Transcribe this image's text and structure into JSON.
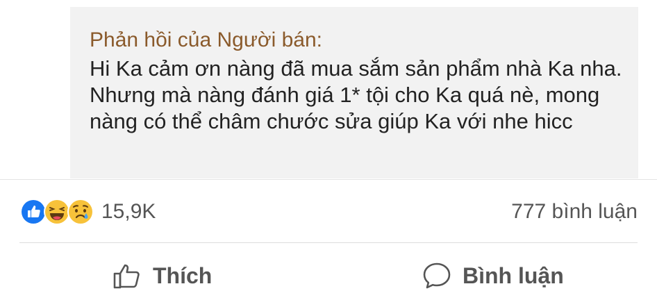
{
  "reply": {
    "label": "Phản hồi của Người bán:",
    "text": "Hi Ka cảm ơn nàng đã mua sắm sản phẩm nhà Ka nha. Nhưng mà nàng đánh giá 1* tội cho Ka quá nè, mong nàng có thể châm chước sửa giúp Ka với nhe hicc"
  },
  "stats": {
    "reactions": [
      "like-icon",
      "haha-icon",
      "sad-icon"
    ],
    "reaction_count": "15,9K",
    "comment_count": "777 bình luận"
  },
  "actions": {
    "like_label": "Thích",
    "comment_label": "Bình luận"
  },
  "colors": {
    "like_blue": "#1877f2",
    "emoji_yellow": "#f7c23a",
    "label_brown": "#8a5a2b",
    "reply_bg": "#f2f2f2"
  }
}
